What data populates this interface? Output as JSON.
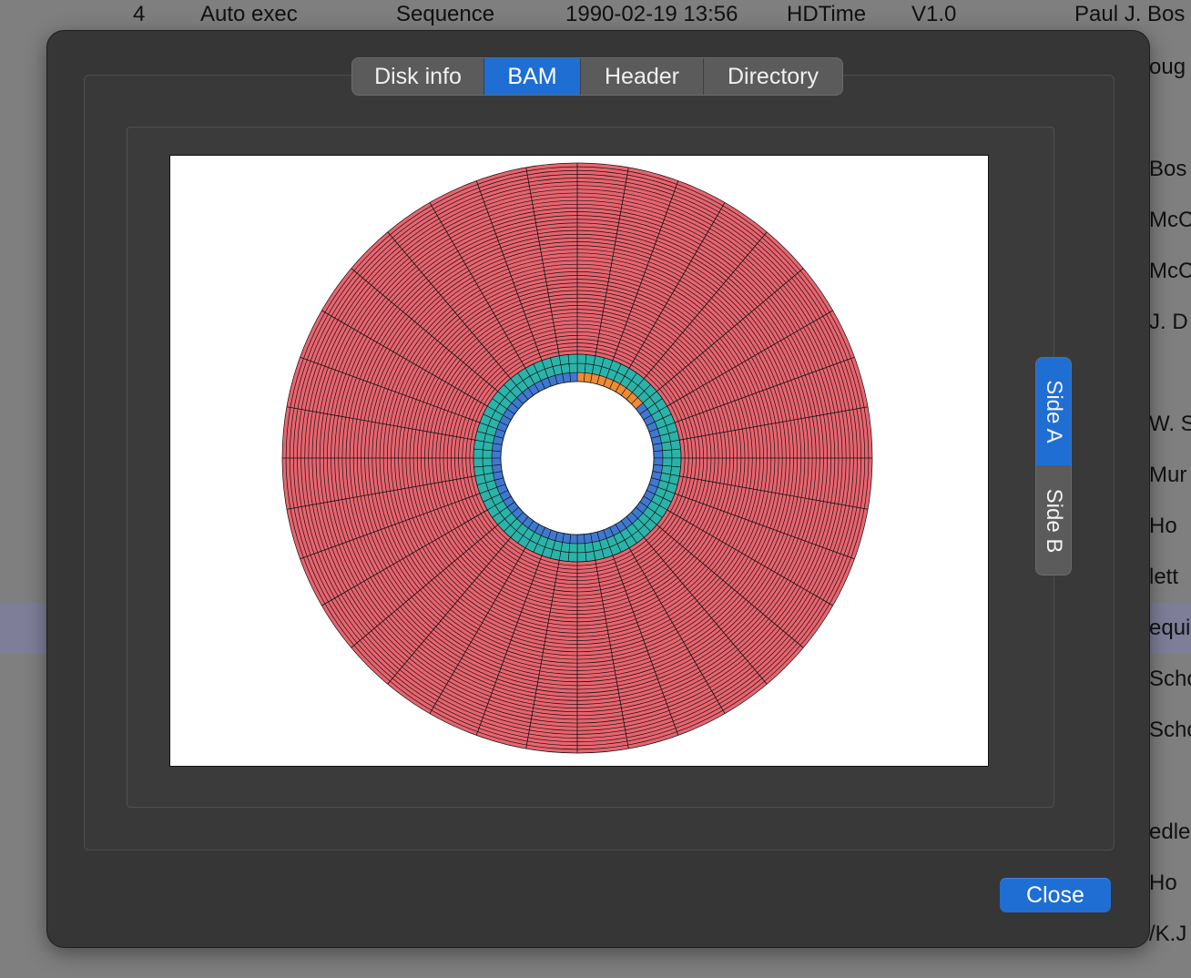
{
  "background": {
    "top_row": {
      "index": "4",
      "type": "Auto exec",
      "category": "Sequence",
      "date": "1990-02-19 13:56",
      "program": "HDTime",
      "version": "V1.0",
      "author": "Paul J. Bos"
    },
    "side_fragments": [
      "oug",
      "Bos",
      "McC",
      "McC",
      "J. D",
      "W. S",
      "Mur",
      "Ho",
      "lett",
      "equi",
      "Scho",
      "Scho",
      "edle",
      "Ho",
      "/K.J"
    ]
  },
  "dialog": {
    "tabs": [
      {
        "label": "Disk info",
        "active": false
      },
      {
        "label": "BAM",
        "active": true
      },
      {
        "label": "Header",
        "active": false
      },
      {
        "label": "Directory",
        "active": false
      }
    ],
    "sides": [
      {
        "label": "Side A",
        "active": true
      },
      {
        "label": "Side B",
        "active": false
      }
    ],
    "close_label": "Close"
  },
  "bam": {
    "colors": {
      "used": "#e9646f",
      "directory": "#2bb3a9",
      "header": "#3f78d0",
      "reserved": "#ef8a35",
      "grid": "#111111"
    },
    "sectors_outer_zone": 36,
    "sectors_inner_zone": 72,
    "tracks_outer_zone": 51,
    "tracks_inner_zone": 3,
    "innermost_track": {
      "sectors": 72,
      "reserved_sector_count": 10
    }
  }
}
